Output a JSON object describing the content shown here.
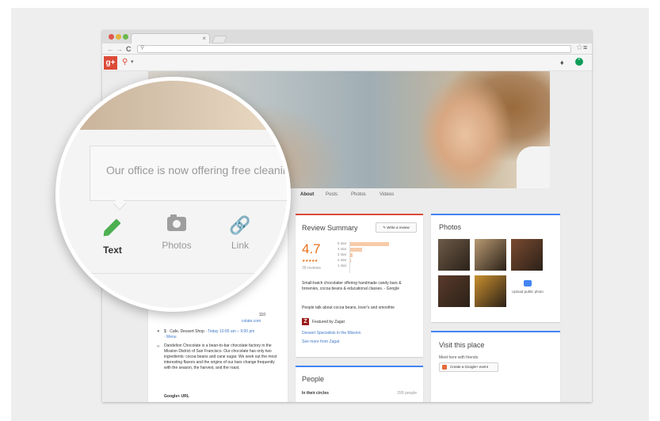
{
  "browser": {
    "tab_close": "×",
    "nav": {
      "back": "←",
      "forward": "→",
      "reload": "C"
    },
    "omnibox_icon": "search-icon",
    "bookmark_icon": "star-icon",
    "menu_icon": "hamburger-menu-icon"
  },
  "gplus_bar": {
    "logo": "g+",
    "pin_icon": "location-pin-icon",
    "caret": "▾",
    "notifications_icon": "bell-icon",
    "hangouts_icon": "hangouts-icon"
  },
  "profile_tabs": [
    "About",
    "Posts",
    "Photos",
    "Videos"
  ],
  "review_summary": {
    "title": "Review Summary",
    "write_review": "Write a review",
    "rating": "4.7",
    "stars": "★★★★★",
    "review_count": "39 reviews",
    "bars": [
      {
        "label": "5 star",
        "fraction": 0.82
      },
      {
        "label": "4 star",
        "fraction": 0.25
      },
      {
        "label": "3 star",
        "fraction": 0.05
      },
      {
        "label": "2 star",
        "fraction": 0.02
      },
      {
        "label": "1 star",
        "fraction": 0.0
      }
    ],
    "description": "Small-batch chocolatier offering handmade candy bars & brownies, cocoa beans & educational classes. - Google",
    "people_talk": "People talk about cocoa beans, lover's and smoothie",
    "zagat_logo": "Z",
    "featured_by": "Featured by Zagat",
    "dessert_link": "Dessert Specialists in the Mission",
    "more_link": "See more from Zagat"
  },
  "photos": {
    "title": "Photos",
    "upload_label": "Upload public photo",
    "thumb_colors": [
      "#6d5b49",
      "#b89a72",
      "#7a4a30",
      "#5a3a2a",
      "#c98f2e"
    ]
  },
  "visit": {
    "title": "Visit this place",
    "subtitle": "Meet here with friends",
    "event_button": "Create a Google+ event"
  },
  "people": {
    "title": "People",
    "in_circles": "In their circles",
    "count": "299 people"
  },
  "about": {
    "phone_partial": "110",
    "website_partial": "colate.com",
    "category_prefix": "$ · Cafe, Dessert Shop · ",
    "hours_link": "Today 10:00 am – 9:00 pm",
    "menu_link": "· Menu",
    "quote_mark": "“",
    "description": "Dandelion Chocolate is a bean-to-bar chocolate factory in the Mission District of San Francisco. Our chocolate has only two ingredients: cocoa beans and cane sugar. We seek out the most interesting flavors and the origins of our bars change frequently with the season, the harvest, and the roast.",
    "gplus_url_label": "Google+ URL"
  },
  "magnifier": {
    "post_text": "Our office is now offering free cleanings and",
    "options": [
      {
        "label": "Text",
        "icon": "pencil-icon",
        "active": true
      },
      {
        "label": "Photos",
        "icon": "camera-icon",
        "active": false
      },
      {
        "label": "Link",
        "icon": "link-icon",
        "active": false
      }
    ]
  },
  "colors": {
    "gplus_red": "#dd4b39",
    "accent_blue": "#4285f4",
    "rating_orange": "#e7711b",
    "active_green": "#4caf50"
  }
}
